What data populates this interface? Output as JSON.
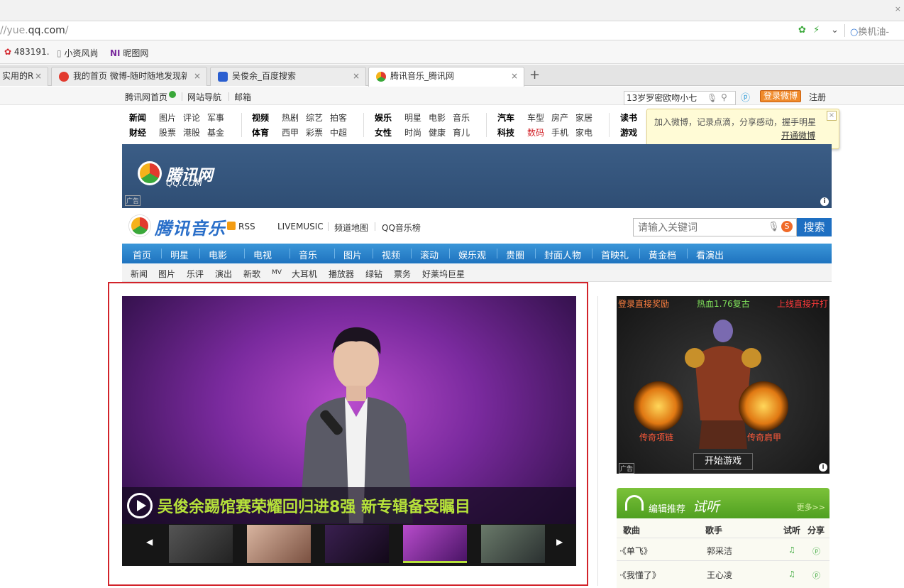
{
  "browser": {
    "url_prefix": "//yue.",
    "url_domain": "qq.com",
    "url_suffix": "/",
    "search_hint": "换机油-",
    "bookmarks": [
      {
        "label": "483191."
      },
      {
        "label": "小资风尚"
      },
      {
        "label": "昵图网"
      }
    ],
    "tabs": [
      {
        "label": "实用的R"
      },
      {
        "label": "我的首页 微博-随时随地发现新"
      },
      {
        "label": "吴俊余_百度搜索"
      },
      {
        "label": "腾讯音乐_腾讯网"
      }
    ],
    "new_tab": "+",
    "close_glyph": "×"
  },
  "qqtop": {
    "home": "腾讯网首页",
    "nav": "网站导航",
    "mail": "邮箱",
    "search_value": "13岁罗密欧吻小七",
    "login_weibo": "登录微博",
    "register": "注册"
  },
  "channels": {
    "col1": {
      "h1": "新闻",
      "h2": "财经",
      "r1": [
        "图片",
        "评论",
        "军事"
      ],
      "r2": [
        "股票",
        "港股",
        "基金"
      ]
    },
    "col2": {
      "h1": "视频",
      "h2": "体育",
      "r1": [
        "热剧",
        "综艺",
        "拍客"
      ],
      "r2": [
        "西甲",
        "彩票",
        "中超"
      ]
    },
    "col3": {
      "h1": "娱乐",
      "h2": "女性",
      "r1": [
        "明星",
        "电影",
        "音乐"
      ],
      "r2": [
        "时尚",
        "健康",
        "育儿"
      ]
    },
    "col4": {
      "h1": "汽车",
      "h2": "科技",
      "r1": [
        "车型",
        "房产",
        "家居"
      ],
      "r2": [
        "数码",
        "手机",
        "家电"
      ]
    },
    "col5": {
      "h1": "读书",
      "h2": "游戏"
    }
  },
  "weibo_tip": {
    "text": "加入微博，记录点滴，分享感动，握手明星",
    "open": "开通微博",
    "close": "×"
  },
  "banner": {
    "logo_text": "腾讯网",
    "logo_sub": "QQ.COM",
    "ad_label": "广告",
    "info": "i"
  },
  "music": {
    "title": "腾讯音乐",
    "rss": "RSS",
    "links": [
      "LIVEMUSIC",
      "频道地图",
      "QQ音乐榜"
    ],
    "search_placeholder": "请输入关键词",
    "search_button": "搜索"
  },
  "main_nav": [
    "首页",
    "明星",
    "电影",
    "电视",
    "音乐",
    "图片",
    "视频",
    "滚动",
    "娱乐观",
    "贵圈",
    "封面人物",
    "首映礼",
    "黄金档",
    "看演出"
  ],
  "sub_nav": [
    "新闻",
    "图片",
    "乐评",
    "演出",
    "新歌",
    "MV",
    "大耳机",
    "播放器",
    "绿钻",
    "票务",
    "好莱坞巨星"
  ],
  "hero": {
    "headline": "吴俊余踢馆赛荣耀回归进8强 新专辑备受瞩目",
    "prev": "◀",
    "next": "▶"
  },
  "side_ad": {
    "t1": "登录直接奖励",
    "t2": "热血1.76复古",
    "t3": "上线直接开打",
    "item1": "传奇项链",
    "item2": "传奇肩甲",
    "start": "开始游戏",
    "ad_label": "广告"
  },
  "recommend": {
    "label": "编辑推荐",
    "title": "试听",
    "more": "更多>>",
    "col_song": "歌曲",
    "col_singer": "歌手",
    "col_listen": "试听",
    "col_share": "分享",
    "rows": [
      {
        "song": "·《单飞》",
        "singer": "郭采洁"
      },
      {
        "song": "·《我懂了》",
        "singer": "王心凌"
      }
    ]
  },
  "colors": {
    "nav_blue": "#1f73bf",
    "highlight_red": "#d2232a",
    "headline_green": "#b6e23a",
    "reco_green": "#4fa020"
  }
}
